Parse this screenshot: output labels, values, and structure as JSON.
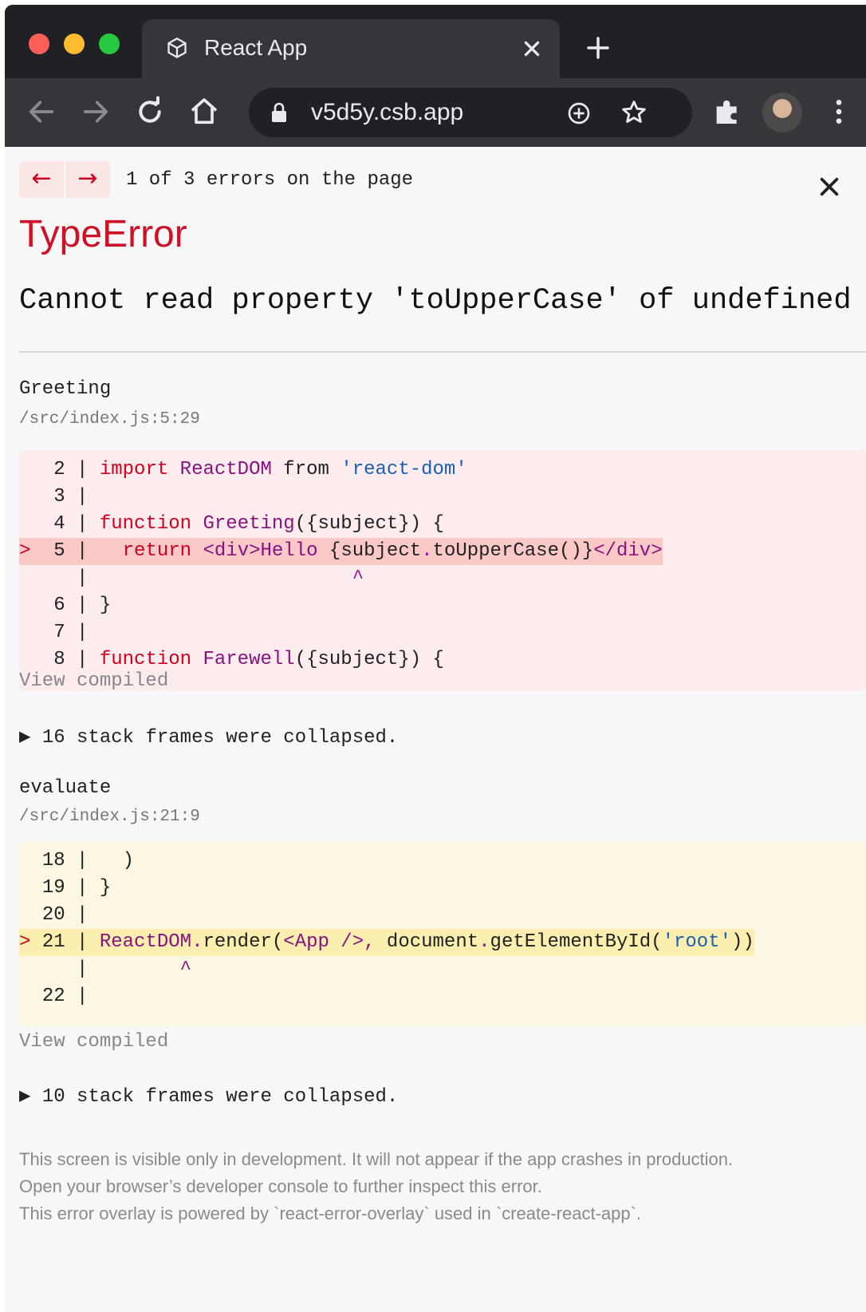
{
  "browser": {
    "tab_title": "React App",
    "url": "v5d5y.csb.app"
  },
  "overlay": {
    "prev_label": "←",
    "next_label": "→",
    "error_count": "1 of 3 errors on the page",
    "error_type": "TypeError",
    "error_message": "Cannot read property 'toUpperCase' of undefined",
    "frames": [
      {
        "name": "Greeting",
        "file": "/src/index.js:5:29",
        "view_compiled": "View compiled",
        "lines": [
          {
            "marker": "  ",
            "num": " 2",
            "sep": " | ",
            "code": "import ReactDOM from 'react-dom'"
          },
          {
            "marker": "  ",
            "num": " 3",
            "sep": " |",
            "code": ""
          },
          {
            "marker": "  ",
            "num": " 4",
            "sep": " | ",
            "code": "function Greeting({subject}) {"
          },
          {
            "marker": "> ",
            "num": " 5",
            "sep": " | ",
            "code": "  return <div>Hello {subject.toUpperCase()}</div>"
          },
          {
            "marker": "  ",
            "num": "  ",
            "sep": " |",
            "code": "                       ^"
          },
          {
            "marker": "  ",
            "num": " 6",
            "sep": " | ",
            "code": "}"
          },
          {
            "marker": "  ",
            "num": " 7",
            "sep": " |",
            "code": ""
          },
          {
            "marker": "  ",
            "num": " 8",
            "sep": " | ",
            "code": "function Farewell({subject}) {"
          }
        ]
      },
      {
        "name": "evaluate",
        "file": "/src/index.js:21:9",
        "view_compiled": "View compiled",
        "lines": [
          {
            "marker": "  ",
            "num": "18",
            "sep": " | ",
            "code": "  )"
          },
          {
            "marker": "  ",
            "num": "19",
            "sep": " | ",
            "code": "}"
          },
          {
            "marker": "  ",
            "num": "20",
            "sep": " |",
            "code": ""
          },
          {
            "marker": "> ",
            "num": "21",
            "sep": " | ",
            "code": "ReactDOM.render(<App />, document.getElementById('root'))"
          },
          {
            "marker": "  ",
            "num": "  ",
            "sep": " |",
            "code": "        ^"
          },
          {
            "marker": "  ",
            "num": "22",
            "sep": " |",
            "code": ""
          }
        ]
      }
    ],
    "collapsed_1": "▶ 16 stack frames were collapsed.",
    "collapsed_2": "▶ 10 stack frames were collapsed.",
    "footer": [
      "This screen is visible only in development. It will not appear if the app crashes in production.",
      "Open your browser’s developer console to further inspect this error.",
      "This error overlay is powered by `react-error-overlay` used in `create-react-app`."
    ]
  },
  "colors": {
    "error_red": "#ce1126",
    "keyword_red": "#d1001f",
    "function_purple": "#881280",
    "string_blue": "#1a5fb4",
    "code_red_bg": "#fcecee",
    "code_yellow_bg": "#fbf7e2"
  },
  "icons": {
    "traffic_lights": [
      "close-light",
      "minimize-light",
      "zoom-light"
    ],
    "tab": [
      "codesandbox-icon",
      "tab-close-icon",
      "new-tab-icon"
    ],
    "toolbar": [
      "back-icon",
      "forward-icon",
      "reload-icon",
      "home-icon",
      "lock-icon",
      "install-icon",
      "star-icon",
      "extensions-icon",
      "profile-avatar",
      "menu-icon"
    ]
  }
}
